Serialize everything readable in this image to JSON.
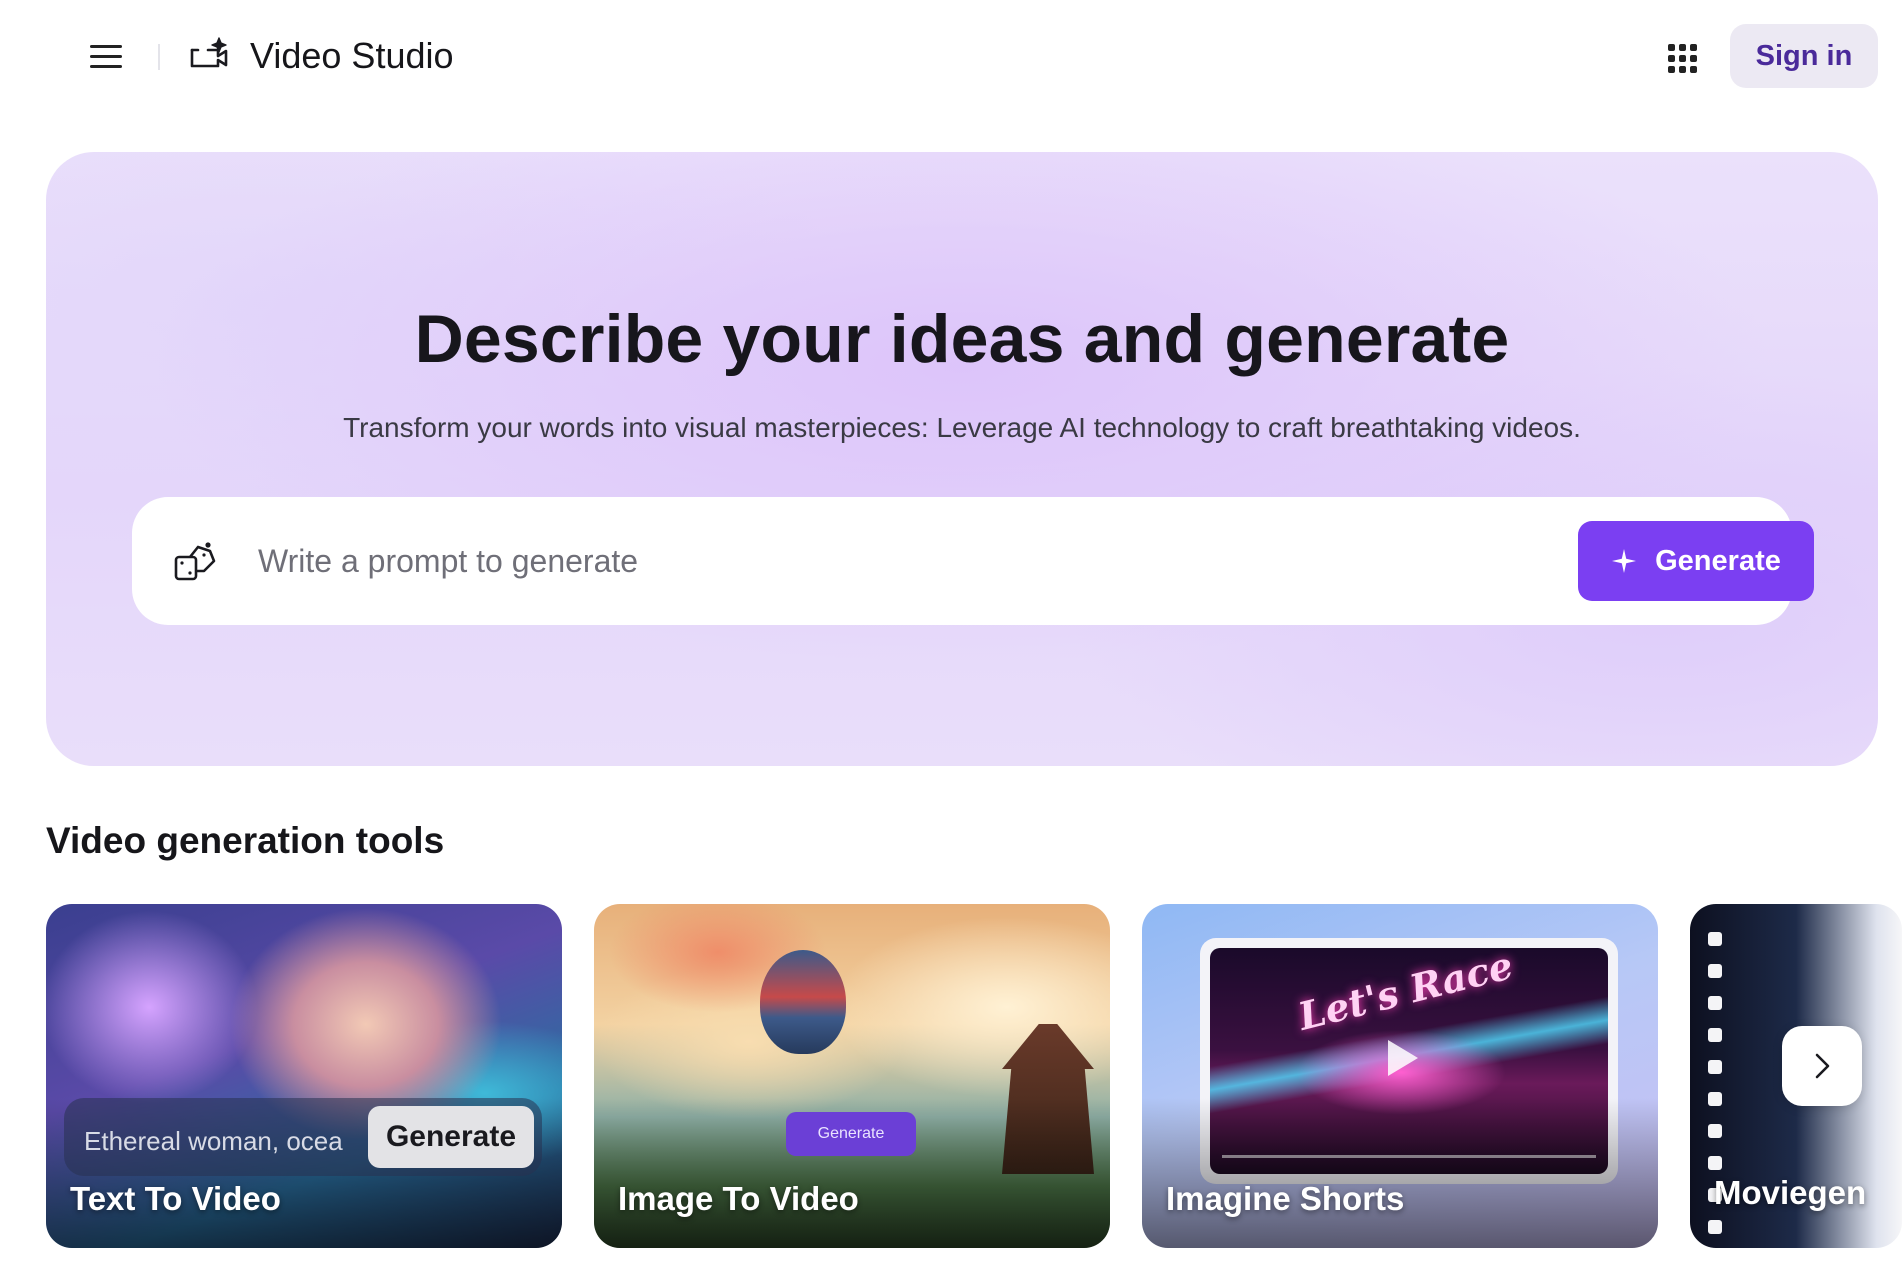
{
  "header": {
    "app_title": "Video Studio",
    "menu_icon": "hamburger-menu-icon",
    "logo_icon": "video-sparkle-icon",
    "apps_icon": "grid-apps-icon",
    "sign_in_label": "Sign in"
  },
  "hero": {
    "title": "Describe your ideas and generate",
    "subtitle": "Transform your words into visual masterpieces: Leverage AI technology to craft breathtaking videos.",
    "prompt_placeholder": "Write a prompt to generate",
    "prompt_value": "",
    "dice_icon": "random-prompt-dice-icon",
    "generate_label": "Generate",
    "generate_icon": "sparkle-plus-icon"
  },
  "tools": {
    "section_title": "Video generation tools",
    "cards": [
      {
        "label": "Text To Video",
        "demo_prompt": "Ethereal woman, ocea",
        "demo_button": "Generate"
      },
      {
        "label": "Image To Video",
        "demo_button": "Generate"
      },
      {
        "label": "Imagine Shorts",
        "demo_video_title": "Let's Race"
      },
      {
        "label": "Moviegen"
      }
    ],
    "next_icon": "chevron-right-icon"
  },
  "colors": {
    "accent": "#7b3ff2",
    "sign_in_bg": "#ece9f3",
    "sign_in_text": "#4a2a9a",
    "hero_bg": "#e6d9fa"
  }
}
